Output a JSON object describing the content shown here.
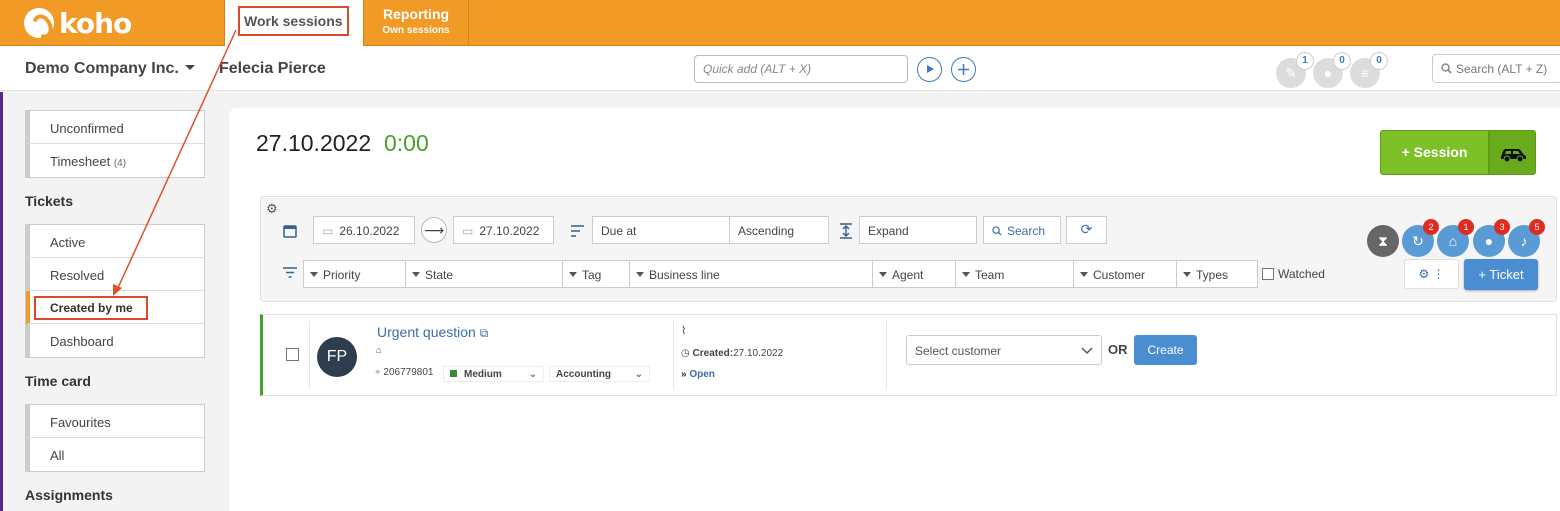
{
  "app": {
    "logo_text": "koho",
    "tabs": [
      {
        "label": "Work sessions"
      },
      {
        "label": "Reporting",
        "sublabel": "Own sessions"
      }
    ]
  },
  "header": {
    "company": "Demo Company Inc.",
    "user": "Felecia Pierce",
    "quick_add_placeholder": "Quick add (ALT + X)",
    "notifications": [
      {
        "icon": "ticket-icon",
        "count": "1"
      },
      {
        "icon": "users-icon",
        "count": "0"
      },
      {
        "icon": "list-icon",
        "count": "0"
      }
    ],
    "search_placeholder": "Search (ALT + Z)"
  },
  "sidebar": {
    "group1": [
      {
        "label": "Unconfirmed"
      },
      {
        "label": "Timesheet",
        "count": "(4)"
      }
    ],
    "tickets_heading": "Tickets",
    "tickets": [
      {
        "label": "Active"
      },
      {
        "label": "Resolved"
      },
      {
        "label": "Created by me"
      },
      {
        "label": "Dashboard"
      }
    ],
    "timecard_heading": "Time card",
    "timecard": [
      {
        "label": "Favourites"
      },
      {
        "label": "All"
      }
    ],
    "assignments_heading": "Assignments"
  },
  "main": {
    "date": "27.10.2022",
    "duration": "0:00",
    "session_button": "+ Session",
    "filters": {
      "date_from": "26.10.2022",
      "date_to": "27.10.2022",
      "sort_field": "Due at",
      "sort_order": "Ascending",
      "expand": "Expand",
      "search_button": "Search",
      "dropdowns": [
        "Priority",
        "State",
        "Tag",
        "Business line",
        "Agent",
        "Team",
        "Customer",
        "Types"
      ],
      "watched_label": "Watched",
      "ticket_button": "+ Ticket",
      "badges": [
        "2",
        "1",
        "3",
        "5"
      ]
    },
    "ticket": {
      "initials": "FP",
      "subject": "Urgent question",
      "id": "206779801",
      "priority": "Medium",
      "business_line": "Accounting",
      "created_label": "Created:",
      "created_date": "27.10.2022",
      "status": "Open",
      "customer_placeholder": "Select customer",
      "or_text": "OR",
      "create_button": "Create"
    }
  }
}
